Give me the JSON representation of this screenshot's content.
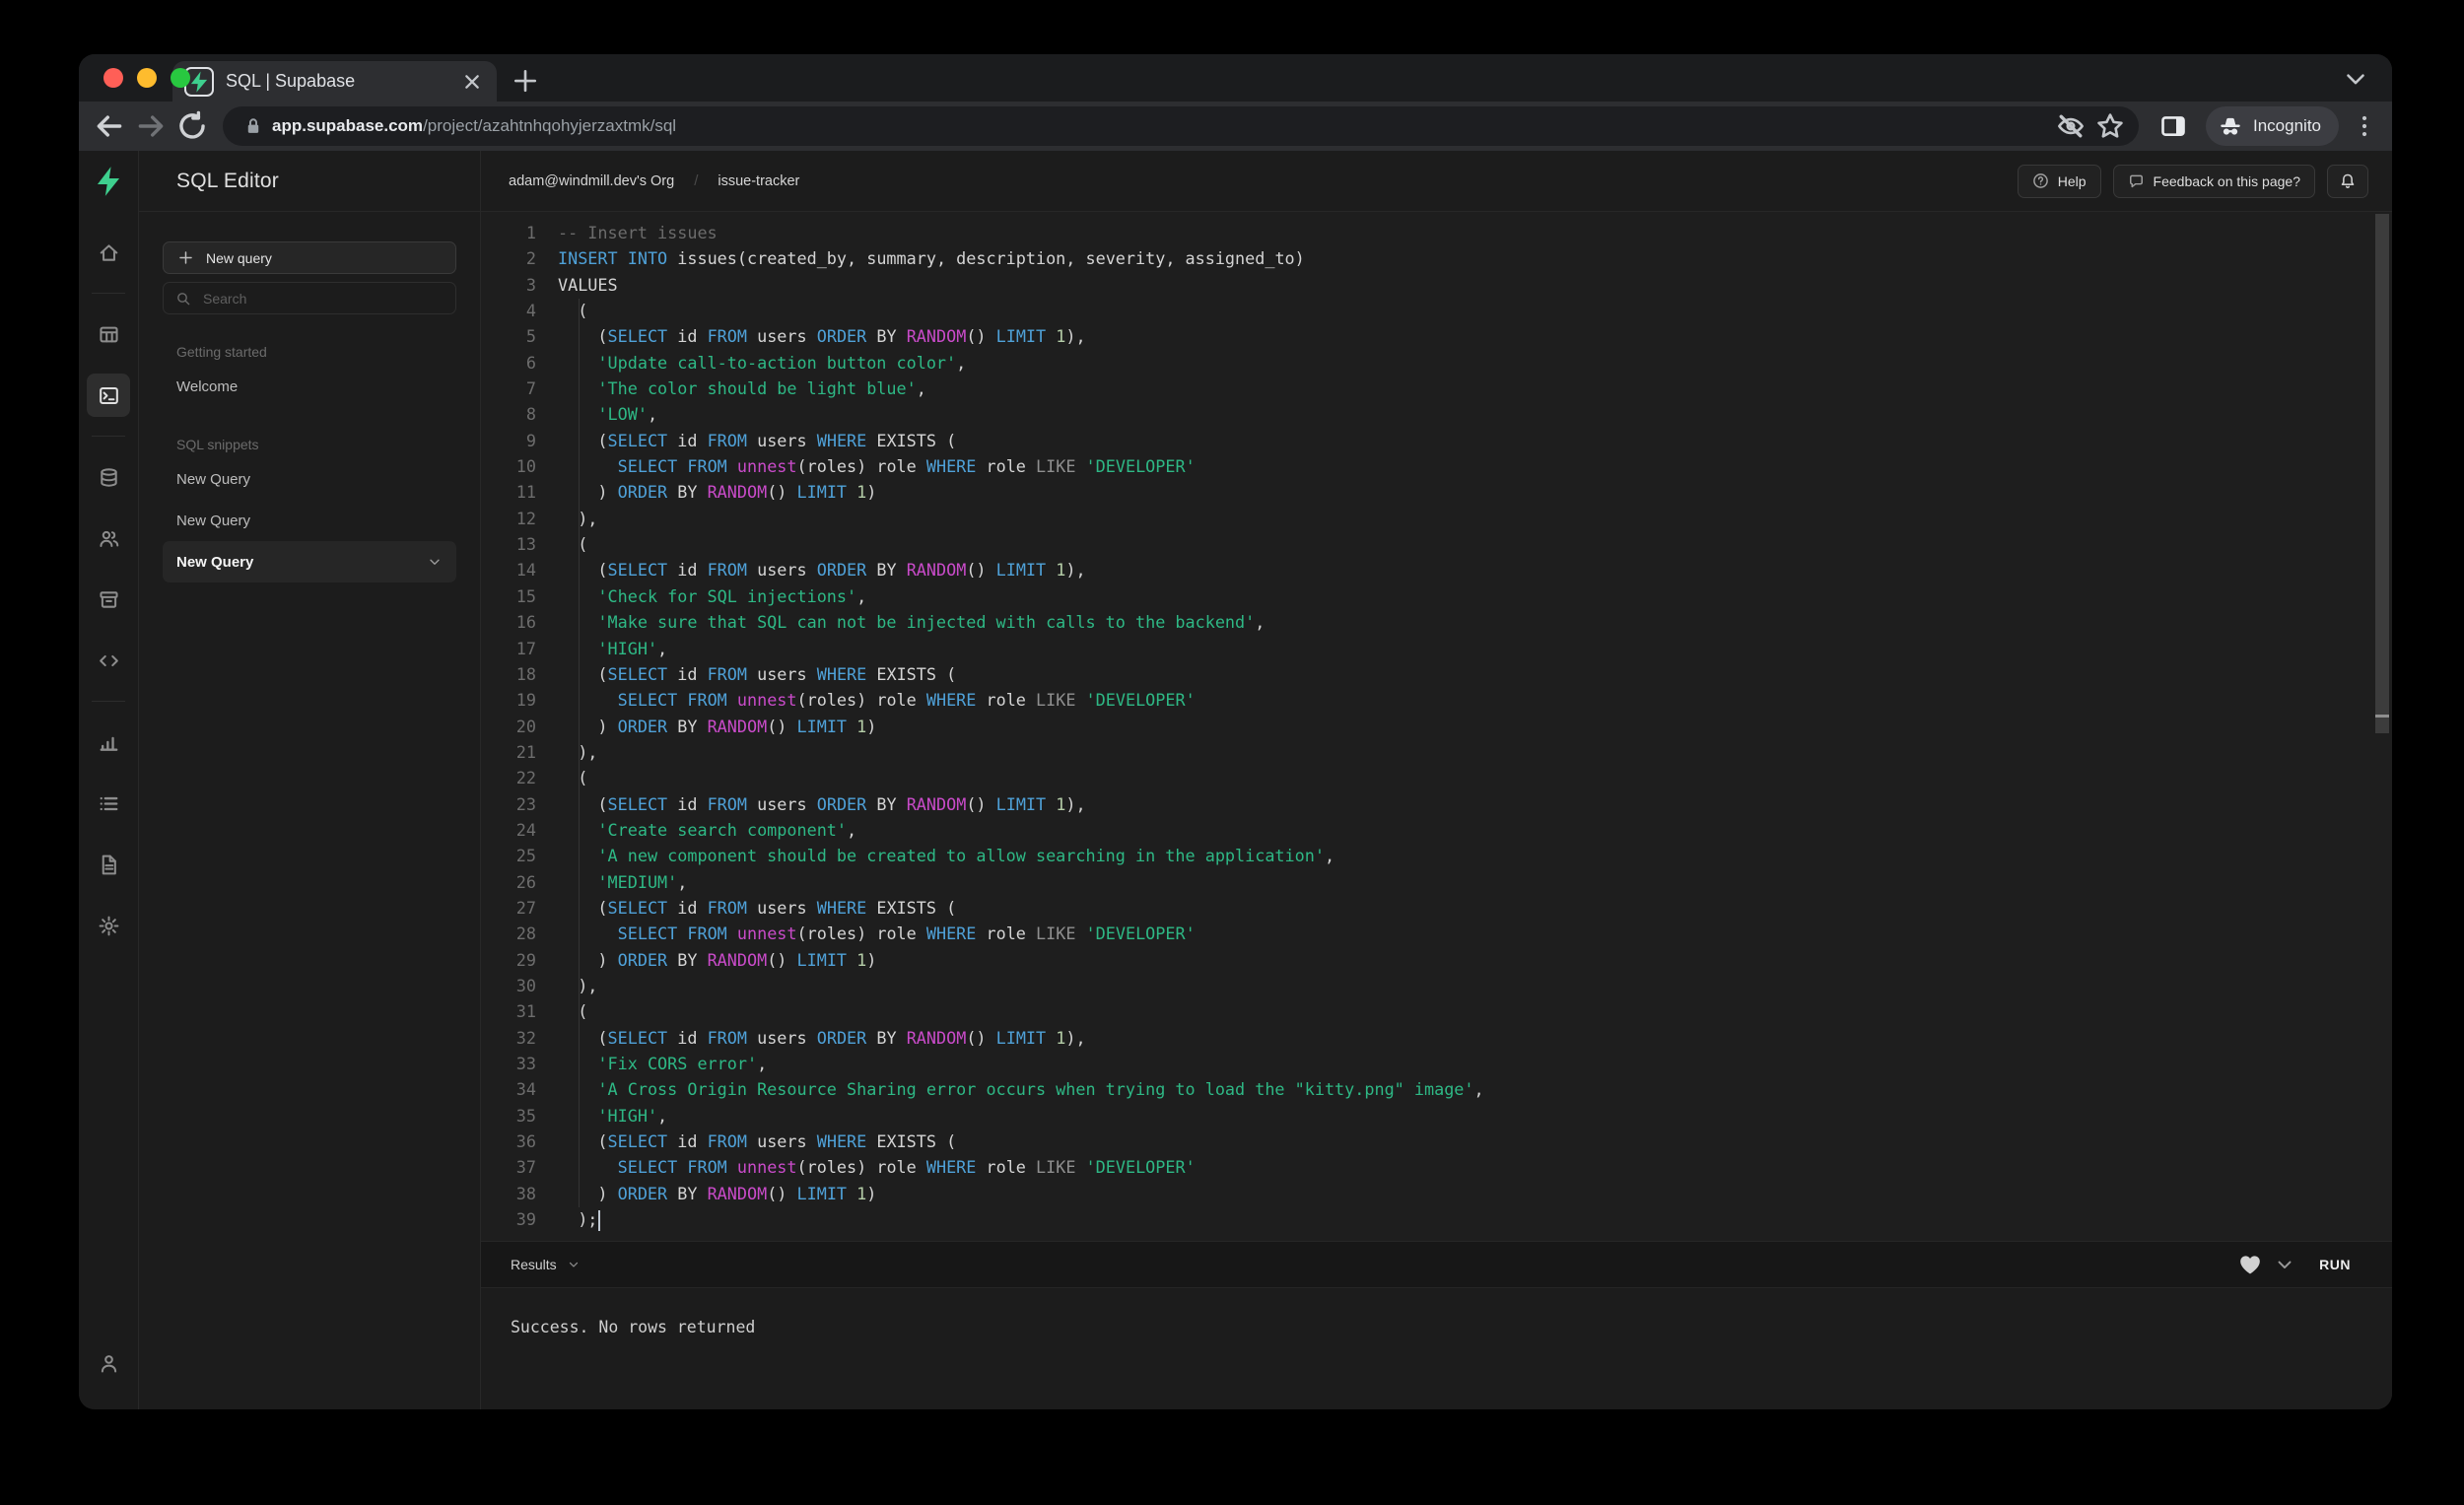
{
  "browser": {
    "traffic_lights": [
      {
        "name": "close",
        "color": "#ff5f57"
      },
      {
        "name": "minimize",
        "color": "#febc2e"
      },
      {
        "name": "zoom",
        "color": "#28c840"
      }
    ],
    "tab": {
      "title": "SQL | Supabase",
      "favicon": "supabase-logo"
    },
    "url": {
      "host": "app.supabase.com",
      "path": "/project/azahtnhqohyjerzaxtmk/sql"
    },
    "incognito_label": "Incognito"
  },
  "app": {
    "accent_green": "#3ecf8e",
    "rail": {
      "items": [
        {
          "icon": "home-icon"
        },
        {
          "divider": true
        },
        {
          "icon": "table-editor-icon"
        },
        {
          "icon": "sql-editor-icon",
          "active": true
        },
        {
          "divider": true
        },
        {
          "icon": "database-icon"
        },
        {
          "icon": "auth-users-icon"
        },
        {
          "icon": "storage-icon"
        },
        {
          "icon": "api-code-icon"
        },
        {
          "divider": true
        },
        {
          "icon": "reports-icon"
        },
        {
          "icon": "logs-icon"
        },
        {
          "icon": "docs-icon"
        },
        {
          "icon": "settings-gear-icon"
        }
      ],
      "bottom_icon": "account-person-icon"
    },
    "panel": {
      "title": "SQL Editor",
      "new_query_button": "New query",
      "search_placeholder": "Search",
      "sections": [
        {
          "heading": "Getting started",
          "items": [
            {
              "label": "Welcome",
              "active": false
            }
          ]
        },
        {
          "heading": "SQL snippets",
          "items": [
            {
              "label": "New Query",
              "active": false
            },
            {
              "label": "New Query",
              "active": false
            },
            {
              "label": "New Query",
              "active": true
            }
          ]
        }
      ]
    },
    "header": {
      "breadcrumb": [
        "adam@windmill.dev's Org",
        "issue-tracker"
      ],
      "help_button": "Help",
      "feedback_button": "Feedback on this page?"
    },
    "editor": {
      "syntax_colors": {
        "keyword": "#4fa1d8",
        "function": "#c94bc9",
        "string": "#2eb885",
        "number": "#b5cea8",
        "comment": "#6b6b6b",
        "operator": "#8f8f8f",
        "plain": "#d4d4d4"
      },
      "lines": [
        [
          [
            "cmt",
            "-- Insert issues"
          ]
        ],
        [
          [
            "kw",
            "INSERT"
          ],
          [
            "pl",
            " "
          ],
          [
            "kw",
            "INTO"
          ],
          [
            "pl",
            " issues(created_by, summary, description, severity, assigned_to)"
          ]
        ],
        [
          [
            "pl",
            "VALUES"
          ]
        ],
        [
          [
            "pl",
            "  ("
          ]
        ],
        [
          [
            "pl",
            "    ("
          ],
          [
            "kw",
            "SELECT"
          ],
          [
            "pl",
            " id "
          ],
          [
            "kw",
            "FROM"
          ],
          [
            "pl",
            " users "
          ],
          [
            "kw",
            "ORDER"
          ],
          [
            "pl",
            " BY "
          ],
          [
            "fn",
            "RANDOM"
          ],
          [
            "pl",
            "() "
          ],
          [
            "kw",
            "LIMIT"
          ],
          [
            "pl",
            " "
          ],
          [
            "num",
            "1"
          ],
          [
            "pl",
            "),"
          ]
        ],
        [
          [
            "pl",
            "    "
          ],
          [
            "str",
            "'Update call-to-action button color'"
          ],
          [
            "pl",
            ","
          ]
        ],
        [
          [
            "pl",
            "    "
          ],
          [
            "str",
            "'The color should be light blue'"
          ],
          [
            "pl",
            ","
          ]
        ],
        [
          [
            "pl",
            "    "
          ],
          [
            "str",
            "'LOW'"
          ],
          [
            "pl",
            ","
          ]
        ],
        [
          [
            "pl",
            "    ("
          ],
          [
            "kw",
            "SELECT"
          ],
          [
            "pl",
            " id "
          ],
          [
            "kw",
            "FROM"
          ],
          [
            "pl",
            " users "
          ],
          [
            "kw",
            "WHERE"
          ],
          [
            "pl",
            " EXISTS ("
          ]
        ],
        [
          [
            "pl",
            "      "
          ],
          [
            "kw",
            "SELECT"
          ],
          [
            "pl",
            " "
          ],
          [
            "kw",
            "FROM"
          ],
          [
            "pl",
            " "
          ],
          [
            "fn",
            "unnest"
          ],
          [
            "pl",
            "(roles) role "
          ],
          [
            "kw",
            "WHERE"
          ],
          [
            "pl",
            " role "
          ],
          [
            "op",
            "LIKE"
          ],
          [
            "pl",
            " "
          ],
          [
            "str",
            "'DEVELOPER'"
          ]
        ],
        [
          [
            "pl",
            "    ) "
          ],
          [
            "kw",
            "ORDER"
          ],
          [
            "pl",
            " BY "
          ],
          [
            "fn",
            "RANDOM"
          ],
          [
            "pl",
            "() "
          ],
          [
            "kw",
            "LIMIT"
          ],
          [
            "pl",
            " "
          ],
          [
            "num",
            "1"
          ],
          [
            "pl",
            ")"
          ]
        ],
        [
          [
            "pl",
            "  ),"
          ]
        ],
        [
          [
            "pl",
            "  ("
          ]
        ],
        [
          [
            "pl",
            "    ("
          ],
          [
            "kw",
            "SELECT"
          ],
          [
            "pl",
            " id "
          ],
          [
            "kw",
            "FROM"
          ],
          [
            "pl",
            " users "
          ],
          [
            "kw",
            "ORDER"
          ],
          [
            "pl",
            " BY "
          ],
          [
            "fn",
            "RANDOM"
          ],
          [
            "pl",
            "() "
          ],
          [
            "kw",
            "LIMIT"
          ],
          [
            "pl",
            " "
          ],
          [
            "num",
            "1"
          ],
          [
            "pl",
            "),"
          ]
        ],
        [
          [
            "pl",
            "    "
          ],
          [
            "str",
            "'Check for SQL injections'"
          ],
          [
            "pl",
            ","
          ]
        ],
        [
          [
            "pl",
            "    "
          ],
          [
            "str",
            "'Make sure that SQL can not be injected with calls to the backend'"
          ],
          [
            "pl",
            ","
          ]
        ],
        [
          [
            "pl",
            "    "
          ],
          [
            "str",
            "'HIGH'"
          ],
          [
            "pl",
            ","
          ]
        ],
        [
          [
            "pl",
            "    ("
          ],
          [
            "kw",
            "SELECT"
          ],
          [
            "pl",
            " id "
          ],
          [
            "kw",
            "FROM"
          ],
          [
            "pl",
            " users "
          ],
          [
            "kw",
            "WHERE"
          ],
          [
            "pl",
            " EXISTS ("
          ]
        ],
        [
          [
            "pl",
            "      "
          ],
          [
            "kw",
            "SELECT"
          ],
          [
            "pl",
            " "
          ],
          [
            "kw",
            "FROM"
          ],
          [
            "pl",
            " "
          ],
          [
            "fn",
            "unnest"
          ],
          [
            "pl",
            "(roles) role "
          ],
          [
            "kw",
            "WHERE"
          ],
          [
            "pl",
            " role "
          ],
          [
            "op",
            "LIKE"
          ],
          [
            "pl",
            " "
          ],
          [
            "str",
            "'DEVELOPER'"
          ]
        ],
        [
          [
            "pl",
            "    ) "
          ],
          [
            "kw",
            "ORDER"
          ],
          [
            "pl",
            " BY "
          ],
          [
            "fn",
            "RANDOM"
          ],
          [
            "pl",
            "() "
          ],
          [
            "kw",
            "LIMIT"
          ],
          [
            "pl",
            " "
          ],
          [
            "num",
            "1"
          ],
          [
            "pl",
            ")"
          ]
        ],
        [
          [
            "pl",
            "  ),"
          ]
        ],
        [
          [
            "pl",
            "  ("
          ]
        ],
        [
          [
            "pl",
            "    ("
          ],
          [
            "kw",
            "SELECT"
          ],
          [
            "pl",
            " id "
          ],
          [
            "kw",
            "FROM"
          ],
          [
            "pl",
            " users "
          ],
          [
            "kw",
            "ORDER"
          ],
          [
            "pl",
            " BY "
          ],
          [
            "fn",
            "RANDOM"
          ],
          [
            "pl",
            "() "
          ],
          [
            "kw",
            "LIMIT"
          ],
          [
            "pl",
            " "
          ],
          [
            "num",
            "1"
          ],
          [
            "pl",
            "),"
          ]
        ],
        [
          [
            "pl",
            "    "
          ],
          [
            "str",
            "'Create search component'"
          ],
          [
            "pl",
            ","
          ]
        ],
        [
          [
            "pl",
            "    "
          ],
          [
            "str",
            "'A new component should be created to allow searching in the application'"
          ],
          [
            "pl",
            ","
          ]
        ],
        [
          [
            "pl",
            "    "
          ],
          [
            "str",
            "'MEDIUM'"
          ],
          [
            "pl",
            ","
          ]
        ],
        [
          [
            "pl",
            "    ("
          ],
          [
            "kw",
            "SELECT"
          ],
          [
            "pl",
            " id "
          ],
          [
            "kw",
            "FROM"
          ],
          [
            "pl",
            " users "
          ],
          [
            "kw",
            "WHERE"
          ],
          [
            "pl",
            " EXISTS ("
          ]
        ],
        [
          [
            "pl",
            "      "
          ],
          [
            "kw",
            "SELECT"
          ],
          [
            "pl",
            " "
          ],
          [
            "kw",
            "FROM"
          ],
          [
            "pl",
            " "
          ],
          [
            "fn",
            "unnest"
          ],
          [
            "pl",
            "(roles) role "
          ],
          [
            "kw",
            "WHERE"
          ],
          [
            "pl",
            " role "
          ],
          [
            "op",
            "LIKE"
          ],
          [
            "pl",
            " "
          ],
          [
            "str",
            "'DEVELOPER'"
          ]
        ],
        [
          [
            "pl",
            "    ) "
          ],
          [
            "kw",
            "ORDER"
          ],
          [
            "pl",
            " BY "
          ],
          [
            "fn",
            "RANDOM"
          ],
          [
            "pl",
            "() "
          ],
          [
            "kw",
            "LIMIT"
          ],
          [
            "pl",
            " "
          ],
          [
            "num",
            "1"
          ],
          [
            "pl",
            ")"
          ]
        ],
        [
          [
            "pl",
            "  ),"
          ]
        ],
        [
          [
            "pl",
            "  ("
          ]
        ],
        [
          [
            "pl",
            "    ("
          ],
          [
            "kw",
            "SELECT"
          ],
          [
            "pl",
            " id "
          ],
          [
            "kw",
            "FROM"
          ],
          [
            "pl",
            " users "
          ],
          [
            "kw",
            "ORDER"
          ],
          [
            "pl",
            " BY "
          ],
          [
            "fn",
            "RANDOM"
          ],
          [
            "pl",
            "() "
          ],
          [
            "kw",
            "LIMIT"
          ],
          [
            "pl",
            " "
          ],
          [
            "num",
            "1"
          ],
          [
            "pl",
            "),"
          ]
        ],
        [
          [
            "pl",
            "    "
          ],
          [
            "str",
            "'Fix CORS error'"
          ],
          [
            "pl",
            ","
          ]
        ],
        [
          [
            "pl",
            "    "
          ],
          [
            "str",
            "'A Cross Origin Resource Sharing error occurs when trying to load the \"kitty.png\" image'"
          ],
          [
            "pl",
            ","
          ]
        ],
        [
          [
            "pl",
            "    "
          ],
          [
            "str",
            "'HIGH'"
          ],
          [
            "pl",
            ","
          ]
        ],
        [
          [
            "pl",
            "    ("
          ],
          [
            "kw",
            "SELECT"
          ],
          [
            "pl",
            " id "
          ],
          [
            "kw",
            "FROM"
          ],
          [
            "pl",
            " users "
          ],
          [
            "kw",
            "WHERE"
          ],
          [
            "pl",
            " EXISTS ("
          ]
        ],
        [
          [
            "pl",
            "      "
          ],
          [
            "kw",
            "SELECT"
          ],
          [
            "pl",
            " "
          ],
          [
            "kw",
            "FROM"
          ],
          [
            "pl",
            " "
          ],
          [
            "fn",
            "unnest"
          ],
          [
            "pl",
            "(roles) role "
          ],
          [
            "kw",
            "WHERE"
          ],
          [
            "pl",
            " role "
          ],
          [
            "op",
            "LIKE"
          ],
          [
            "pl",
            " "
          ],
          [
            "str",
            "'DEVELOPER'"
          ]
        ],
        [
          [
            "pl",
            "    ) "
          ],
          [
            "kw",
            "ORDER"
          ],
          [
            "pl",
            " BY "
          ],
          [
            "fn",
            "RANDOM"
          ],
          [
            "pl",
            "() "
          ],
          [
            "kw",
            "LIMIT"
          ],
          [
            "pl",
            " "
          ],
          [
            "num",
            "1"
          ],
          [
            "pl",
            ")"
          ]
        ],
        [
          [
            "pl",
            "  );"
          ],
          [
            "cursor",
            ""
          ]
        ]
      ]
    },
    "results_bar": {
      "label": "Results",
      "run_button": "RUN"
    },
    "results_output": "Success. No rows returned"
  }
}
